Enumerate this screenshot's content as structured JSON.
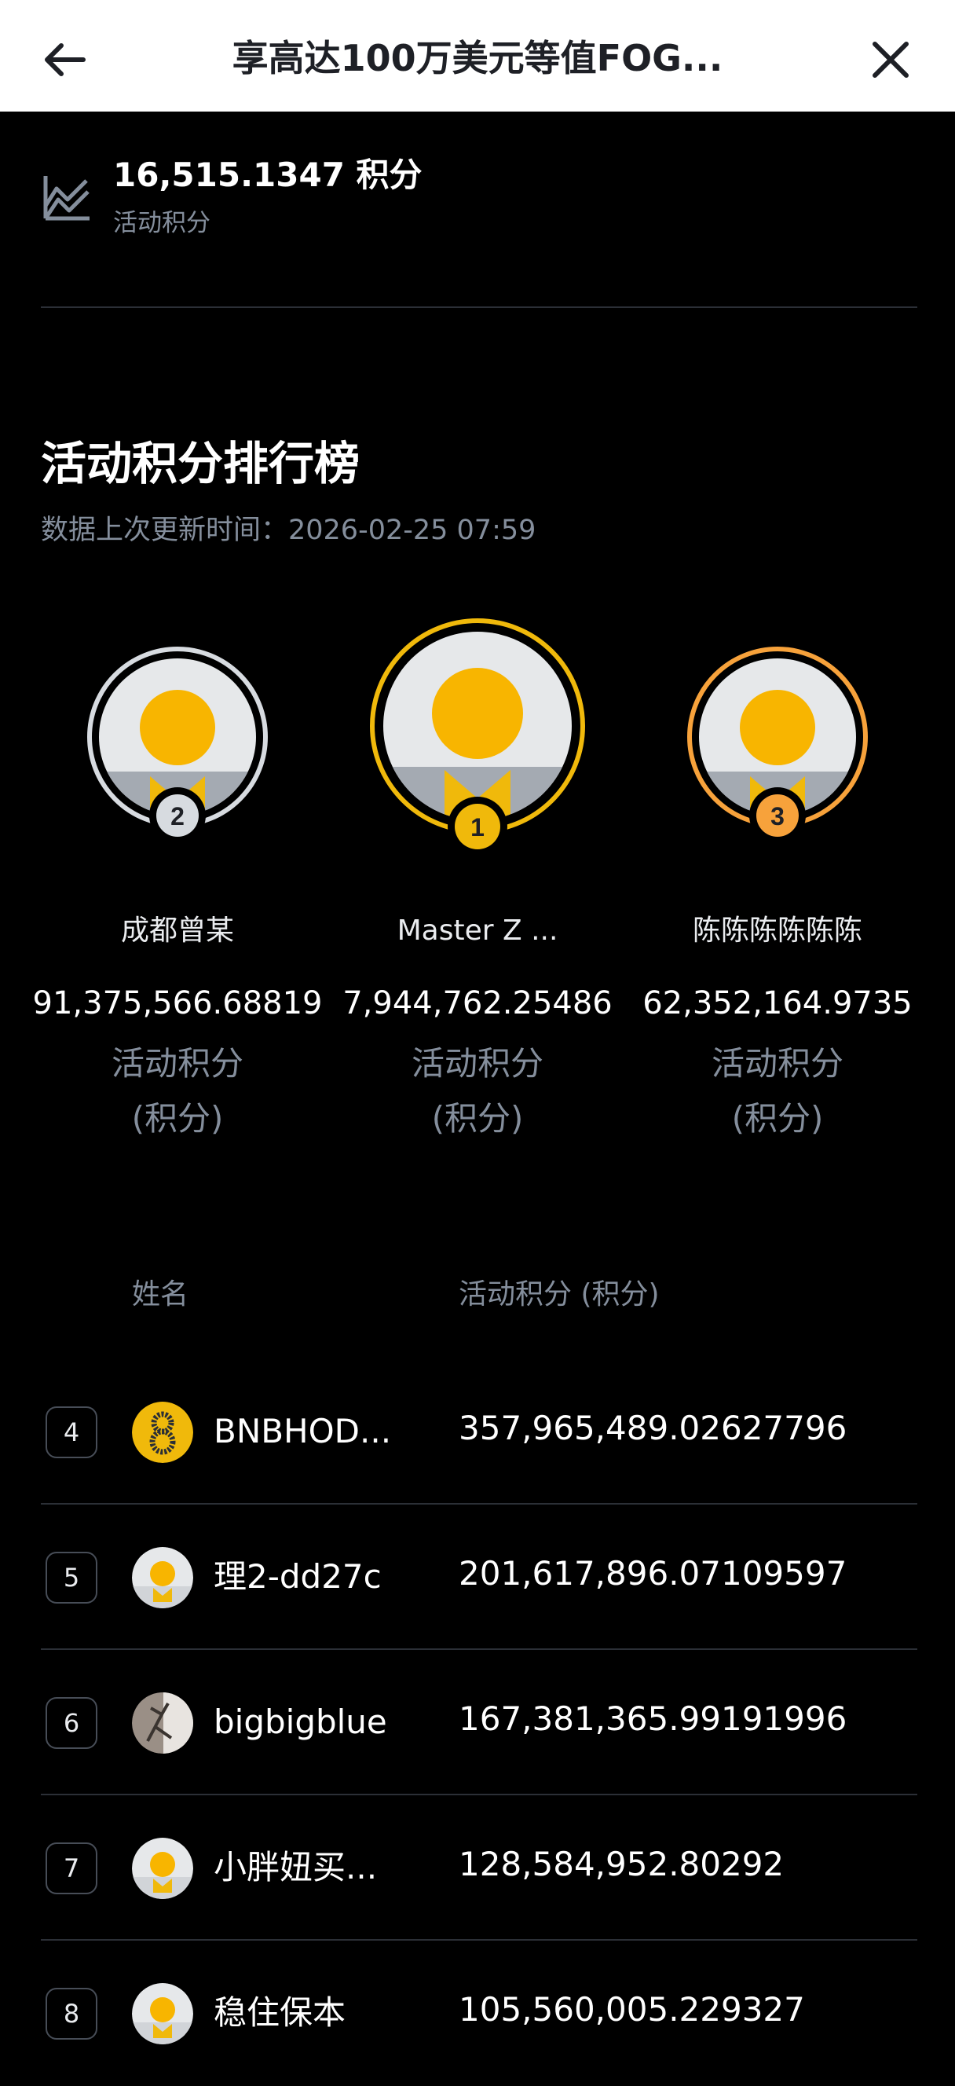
{
  "header": {
    "title": "享高达100万美元等值FOG...",
    "back_icon": "arrow-left-icon",
    "close_icon": "close-icon"
  },
  "my_score": {
    "value": "16,515.1347 积分",
    "label": "活动积分",
    "icon": "chart-line-icon"
  },
  "leaderboard": {
    "title": "活动积分排行榜",
    "update_time": "数据上次更新时间：2026-02-25 07:59",
    "podium": [
      {
        "rank": "2",
        "name": "成都曾某",
        "points": "91,375,566.68819",
        "label": "活动积分",
        "unit": "(积分)",
        "color": "#d7dbe0"
      },
      {
        "rank": "1",
        "name": "Master Z ...",
        "points": "7,944,762.25486",
        "label": "活动积分",
        "unit": "(积分)",
        "color": "#f0b90b"
      },
      {
        "rank": "3",
        "name": "陈陈陈陈陈陈",
        "points": "62,352,164.9735",
        "label": "活动积分",
        "unit": "(积分)",
        "color": "#f7a23b"
      }
    ],
    "columns": {
      "name": "姓名",
      "points": "活动积分 (积分)"
    },
    "rows": [
      {
        "rank": "4",
        "name": "BNBHOD...",
        "points": "357,965,489.02627796",
        "avatar": "bnb-avatar"
      },
      {
        "rank": "5",
        "name": "理2-dd27c",
        "points": "201,617,896.07109597",
        "avatar": "default-avatar"
      },
      {
        "rank": "6",
        "name": "bigbigblue",
        "points": "167,381,365.99191996",
        "avatar": "photo-avatar"
      },
      {
        "rank": "7",
        "name": "小胖妞买...",
        "points": "128,584,952.80292",
        "avatar": "default-avatar"
      },
      {
        "rank": "8",
        "name": "稳住保本",
        "points": "105,560,005.229327",
        "avatar": "default-avatar"
      }
    ]
  }
}
